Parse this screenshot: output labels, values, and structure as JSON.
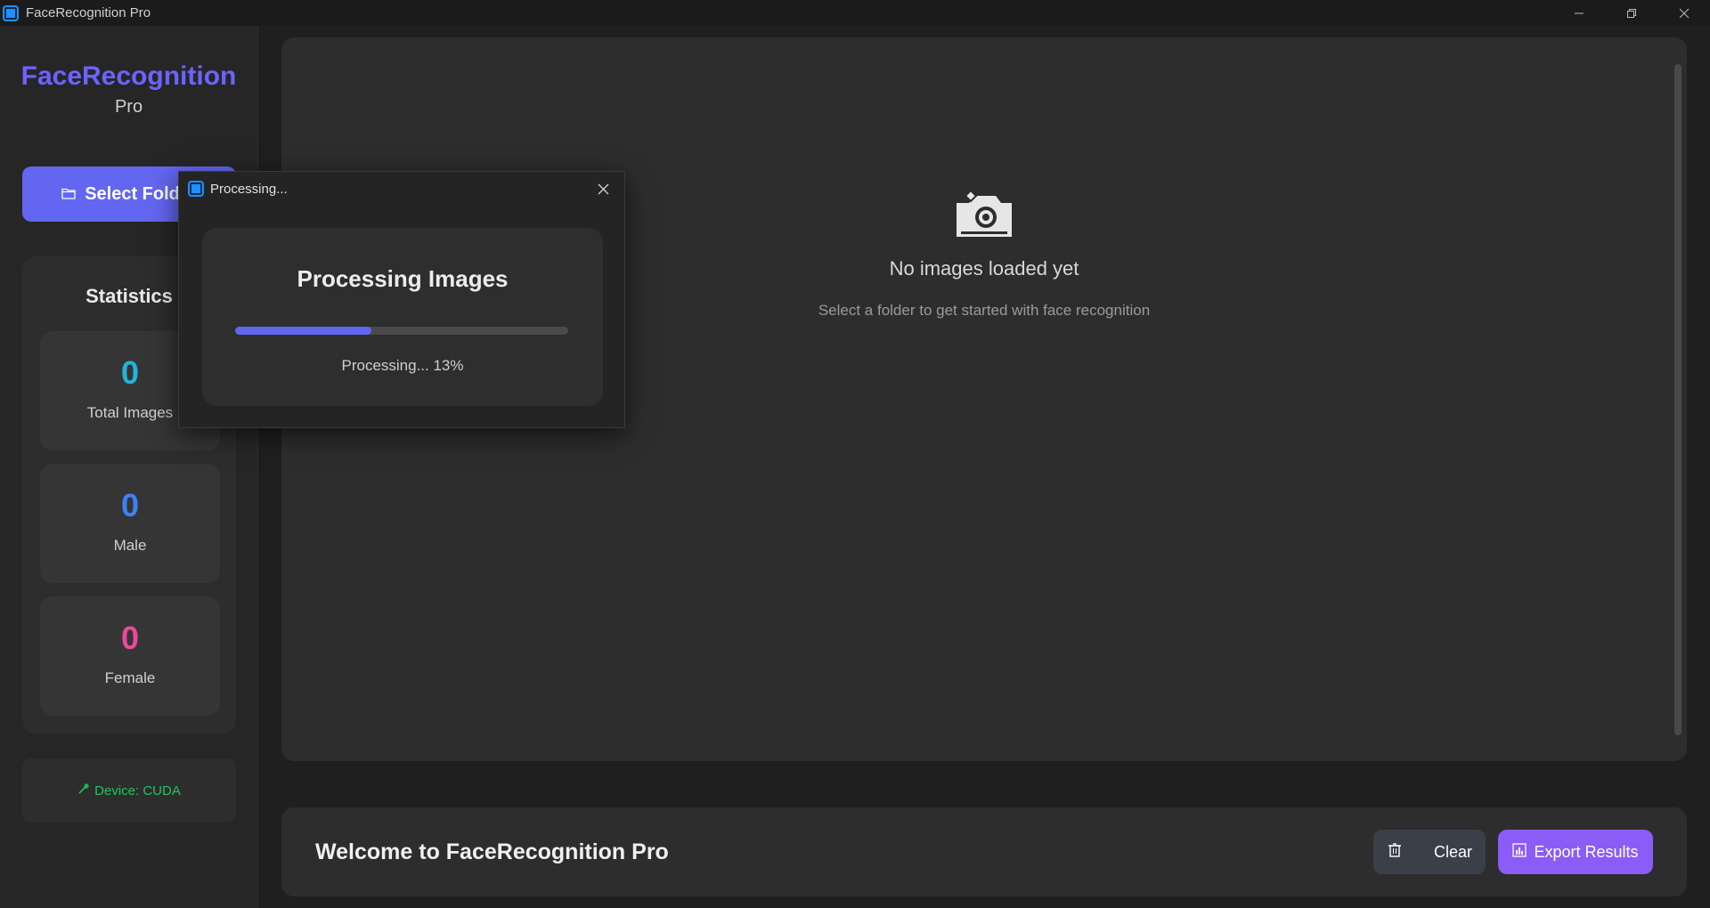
{
  "window": {
    "title": "FaceRecognition Pro"
  },
  "sidebar": {
    "brand_name": "FaceRecognition",
    "brand_sub": "Pro",
    "select_folder_label": "Select Folder",
    "stats_title": "Statistics",
    "stats": [
      {
        "value": "0",
        "label": "Total Images",
        "color": "#22b5d8"
      },
      {
        "value": "0",
        "label": "Male",
        "color": "#3b82f6"
      },
      {
        "value": "0",
        "label": "Female",
        "color": "#ec4899"
      }
    ],
    "device_label": "Device: CUDA"
  },
  "main": {
    "empty_title": "No images loaded yet",
    "empty_subtitle": "Select a folder to get started with face recognition"
  },
  "footer": {
    "welcome": "Welcome to FaceRecognition Pro",
    "clear_label": "Clear",
    "export_label": "Export Results"
  },
  "dialog": {
    "title": "Processing...",
    "heading": "Processing Images",
    "progress_fraction": 0.41,
    "status_text": "Processing... 13%"
  },
  "colors": {
    "accent": "#6366f1",
    "export": "#8b5cf6",
    "device": "#22c55e"
  }
}
